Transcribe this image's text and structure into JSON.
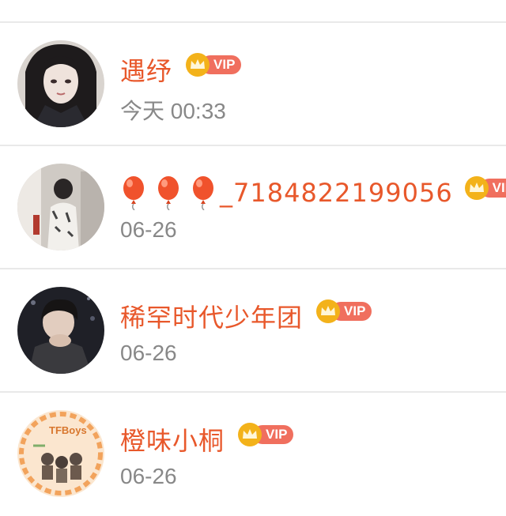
{
  "conversations": [
    {
      "name": "遇纾",
      "vip": "VIP",
      "time": "今天 00:33",
      "avatar": "avatar-dark-hair-girl"
    },
    {
      "name": "_7184822199056",
      "name_prefix_icons": [
        "balloon-icon",
        "balloon-icon",
        "balloon-icon"
      ],
      "vip": "VIP",
      "time": "06-26",
      "avatar": "avatar-mirror-selfie"
    },
    {
      "name": "稀罕时代少年团",
      "vip": "VIP",
      "time": "06-26",
      "avatar": "avatar-night-portrait"
    },
    {
      "name": "橙味小桐",
      "vip": "VIP",
      "time": "06-26",
      "avatar": "avatar-cartoon-group",
      "avatar_text": "TFBoys"
    }
  ],
  "colors": {
    "name": "#e8582b",
    "vip_pill": "#f06f5e",
    "crown": "#f3b21a",
    "time": "#888888",
    "divider": "#e9e9e9"
  }
}
